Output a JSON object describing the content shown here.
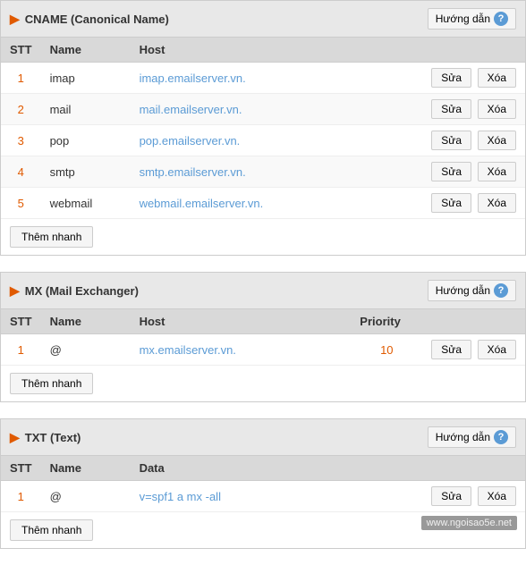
{
  "cname_section": {
    "title": "CNAME (Canonical Name)",
    "guide_label": "Hướng dẫn",
    "headers": [
      "STT",
      "Name",
      "Host",
      ""
    ],
    "rows": [
      {
        "stt": 1,
        "name": "imap",
        "host": "imap.emailserver.vn."
      },
      {
        "stt": 2,
        "name": "mail",
        "host": "mail.emailserver.vn."
      },
      {
        "stt": 3,
        "name": "pop",
        "host": "pop.emailserver.vn."
      },
      {
        "stt": 4,
        "name": "smtp",
        "host": "smtp.emailserver.vn."
      },
      {
        "stt": 5,
        "name": "webmail",
        "host": "webmail.emailserver.vn."
      }
    ],
    "btn_sua": "Sửa",
    "btn_xoa": "Xóa",
    "btn_them": "Thêm nhanh"
  },
  "mx_section": {
    "title": "MX (Mail Exchanger)",
    "guide_label": "Hướng dẫn",
    "headers": [
      "STT",
      "Name",
      "Host",
      "Priority",
      ""
    ],
    "rows": [
      {
        "stt": 1,
        "name": "@",
        "host": "mx.emailserver.vn.",
        "priority": 10
      }
    ],
    "btn_sua": "Sửa",
    "btn_xoa": "Xóa",
    "btn_them": "Thêm nhanh"
  },
  "txt_section": {
    "title": "TXT (Text)",
    "guide_label": "Hướng dẫn",
    "headers": [
      "STT",
      "Name",
      "Data",
      ""
    ],
    "rows": [
      {
        "stt": 1,
        "name": "@",
        "data": "v=spf1 a mx -all"
      }
    ],
    "btn_sua": "Sửa",
    "btn_xoa": "Xóa",
    "btn_them": "Thêm nhanh"
  },
  "watermark": "www.ngoisao5e.net"
}
